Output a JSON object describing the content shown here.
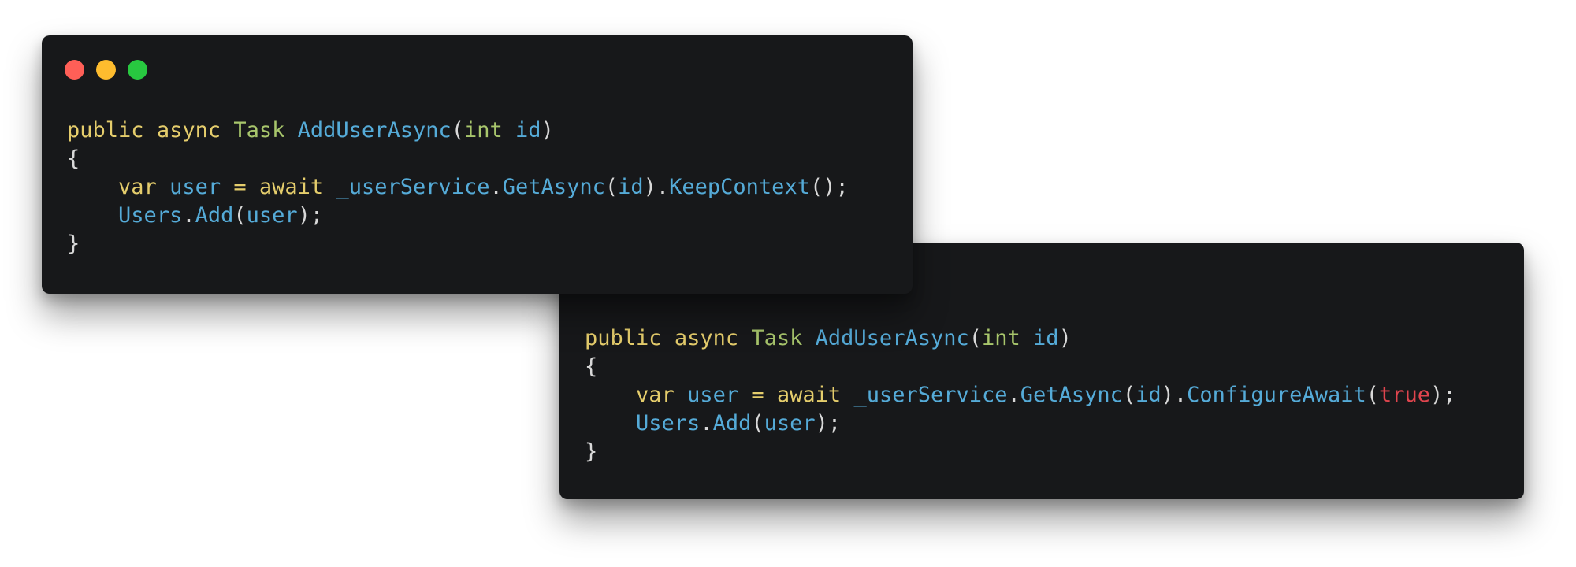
{
  "theme": {
    "window_bg": "#17181a",
    "plain": "#d8d8d8",
    "keyword": "#e5cd6c",
    "type": "#a8c66c",
    "identifier": "#55abd8",
    "literal": "#e0454e",
    "dot_red": "#ff5f57",
    "dot_yellow": "#febc2e",
    "dot_green": "#28c840"
  },
  "windows": [
    {
      "name": "code-window-keep-context",
      "show_dots": true,
      "lines": [
        [
          {
            "t": "public",
            "c": "keyword"
          },
          {
            "t": " ",
            "c": "plain"
          },
          {
            "t": "async",
            "c": "keyword"
          },
          {
            "t": " ",
            "c": "plain"
          },
          {
            "t": "Task",
            "c": "type"
          },
          {
            "t": " ",
            "c": "plain"
          },
          {
            "t": "AddUserAsync",
            "c": "identifier"
          },
          {
            "t": "(",
            "c": "plain"
          },
          {
            "t": "int",
            "c": "type"
          },
          {
            "t": " ",
            "c": "plain"
          },
          {
            "t": "id",
            "c": "identifier"
          },
          {
            "t": ")",
            "c": "plain"
          }
        ],
        [
          {
            "t": "{",
            "c": "plain"
          }
        ],
        [
          {
            "t": "    ",
            "c": "plain"
          },
          {
            "t": "var",
            "c": "keyword"
          },
          {
            "t": " ",
            "c": "plain"
          },
          {
            "t": "user",
            "c": "identifier"
          },
          {
            "t": " ",
            "c": "plain"
          },
          {
            "t": "=",
            "c": "keyword"
          },
          {
            "t": " ",
            "c": "plain"
          },
          {
            "t": "await",
            "c": "keyword"
          },
          {
            "t": " ",
            "c": "plain"
          },
          {
            "t": "_userService",
            "c": "identifier"
          },
          {
            "t": ".",
            "c": "plain"
          },
          {
            "t": "GetAsync",
            "c": "identifier"
          },
          {
            "t": "(",
            "c": "plain"
          },
          {
            "t": "id",
            "c": "identifier"
          },
          {
            "t": ").",
            "c": "plain"
          },
          {
            "t": "KeepContext",
            "c": "identifier"
          },
          {
            "t": "();",
            "c": "plain"
          }
        ],
        [
          {
            "t": "    ",
            "c": "plain"
          },
          {
            "t": "Users",
            "c": "identifier"
          },
          {
            "t": ".",
            "c": "plain"
          },
          {
            "t": "Add",
            "c": "identifier"
          },
          {
            "t": "(",
            "c": "plain"
          },
          {
            "t": "user",
            "c": "identifier"
          },
          {
            "t": ");",
            "c": "plain"
          }
        ],
        [
          {
            "t": "}",
            "c": "plain"
          }
        ]
      ]
    },
    {
      "name": "code-window-configure-await",
      "show_dots": false,
      "lines": [
        [
          {
            "t": "public",
            "c": "keyword"
          },
          {
            "t": " ",
            "c": "plain"
          },
          {
            "t": "async",
            "c": "keyword"
          },
          {
            "t": " ",
            "c": "plain"
          },
          {
            "t": "Task",
            "c": "type"
          },
          {
            "t": " ",
            "c": "plain"
          },
          {
            "t": "AddUserAsync",
            "c": "identifier"
          },
          {
            "t": "(",
            "c": "plain"
          },
          {
            "t": "int",
            "c": "type"
          },
          {
            "t": " ",
            "c": "plain"
          },
          {
            "t": "id",
            "c": "identifier"
          },
          {
            "t": ")",
            "c": "plain"
          }
        ],
        [
          {
            "t": "{",
            "c": "plain"
          }
        ],
        [
          {
            "t": "    ",
            "c": "plain"
          },
          {
            "t": "var",
            "c": "keyword"
          },
          {
            "t": " ",
            "c": "plain"
          },
          {
            "t": "user",
            "c": "identifier"
          },
          {
            "t": " ",
            "c": "plain"
          },
          {
            "t": "=",
            "c": "keyword"
          },
          {
            "t": " ",
            "c": "plain"
          },
          {
            "t": "await",
            "c": "keyword"
          },
          {
            "t": " ",
            "c": "plain"
          },
          {
            "t": "_userService",
            "c": "identifier"
          },
          {
            "t": ".",
            "c": "plain"
          },
          {
            "t": "GetAsync",
            "c": "identifier"
          },
          {
            "t": "(",
            "c": "plain"
          },
          {
            "t": "id",
            "c": "identifier"
          },
          {
            "t": ").",
            "c": "plain"
          },
          {
            "t": "ConfigureAwait",
            "c": "identifier"
          },
          {
            "t": "(",
            "c": "plain"
          },
          {
            "t": "true",
            "c": "literal"
          },
          {
            "t": ");",
            "c": "plain"
          }
        ],
        [
          {
            "t": "    ",
            "c": "plain"
          },
          {
            "t": "Users",
            "c": "identifier"
          },
          {
            "t": ".",
            "c": "plain"
          },
          {
            "t": "Add",
            "c": "identifier"
          },
          {
            "t": "(",
            "c": "plain"
          },
          {
            "t": "user",
            "c": "identifier"
          },
          {
            "t": ");",
            "c": "plain"
          }
        ],
        [
          {
            "t": "}",
            "c": "plain"
          }
        ]
      ]
    }
  ]
}
